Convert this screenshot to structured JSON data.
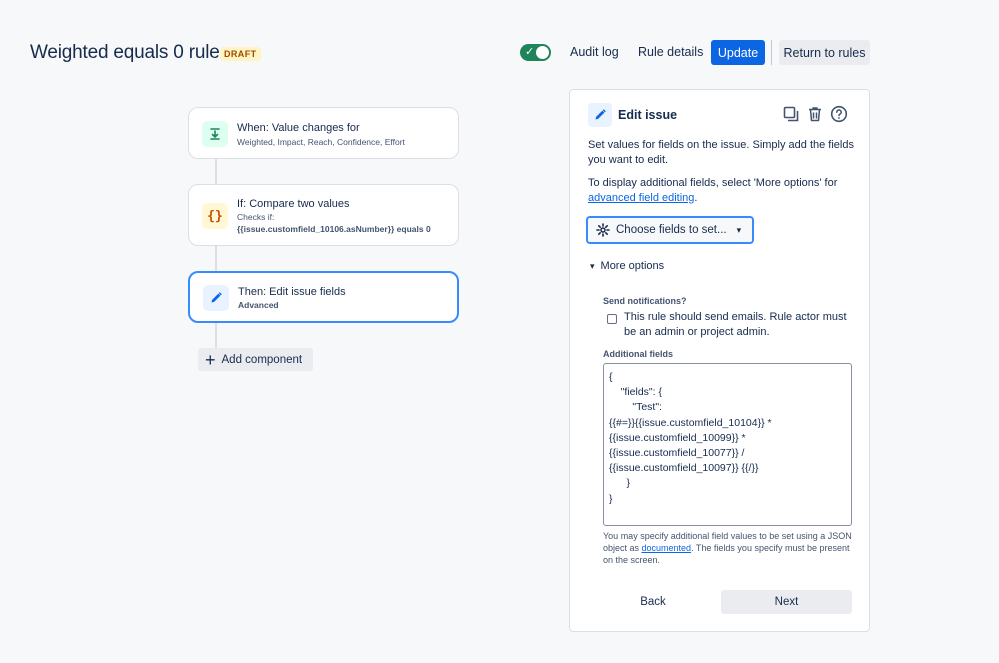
{
  "header": {
    "title": "Weighted equals 0 rule",
    "badge": "DRAFT",
    "audit_log": "Audit log",
    "rule_details": "Rule details",
    "update": "Update",
    "return": "Return to rules",
    "toggle_enabled": true
  },
  "flow": {
    "trigger": {
      "title": "When: Value changes for",
      "subtitle": "Weighted, Impact, Reach, Confidence, Effort",
      "icon": "download-arrow-icon"
    },
    "condition": {
      "title": "If: Compare two values",
      "line1": "Checks if:",
      "line2": "{{issue.customfield_10106.asNumber}} equals 0",
      "icon": "braces-icon"
    },
    "action": {
      "title": "Then: Edit issue fields",
      "subtitle": "Advanced",
      "icon": "pencil-icon"
    },
    "add_component": "Add component"
  },
  "panel": {
    "title": "Edit issue",
    "desc1": "Set values for fields on the issue. Simply add the fields you want to edit.",
    "desc2_prefix": "To display additional fields, select 'More options' for ",
    "desc2_link": "advanced field editing",
    "desc2_suffix": ".",
    "choose_fields": "Choose fields to set...",
    "more_options": "More options",
    "send_notifications_label": "Send notifications?",
    "send_notifications_text": "This rule should send emails. Rule actor must be an admin or project admin.",
    "send_notifications_checked": false,
    "additional_fields_label": "Additional fields",
    "additional_fields_value": "{\n    \"fields\": {\n        \"Test\":\n{{#=}}{{issue.customfield_10104}} *\n{{issue.customfield_10099}} *\n{{issue.customfield_10077}} /\n{{issue.customfield_10097}} {{/}}\n      }\n}",
    "help_prefix": "You may specify additional field values to be set using a JSON object as ",
    "help_link": "documented",
    "help_suffix": ". The fields you specify must be present on the screen.",
    "back": "Back",
    "next": "Next"
  },
  "colors": {
    "primary": "#0c66e4",
    "toggle_on": "#1f845a",
    "selected_border": "#388bff",
    "draft_bg": "#fff4c4",
    "draft_text": "#a54800"
  }
}
